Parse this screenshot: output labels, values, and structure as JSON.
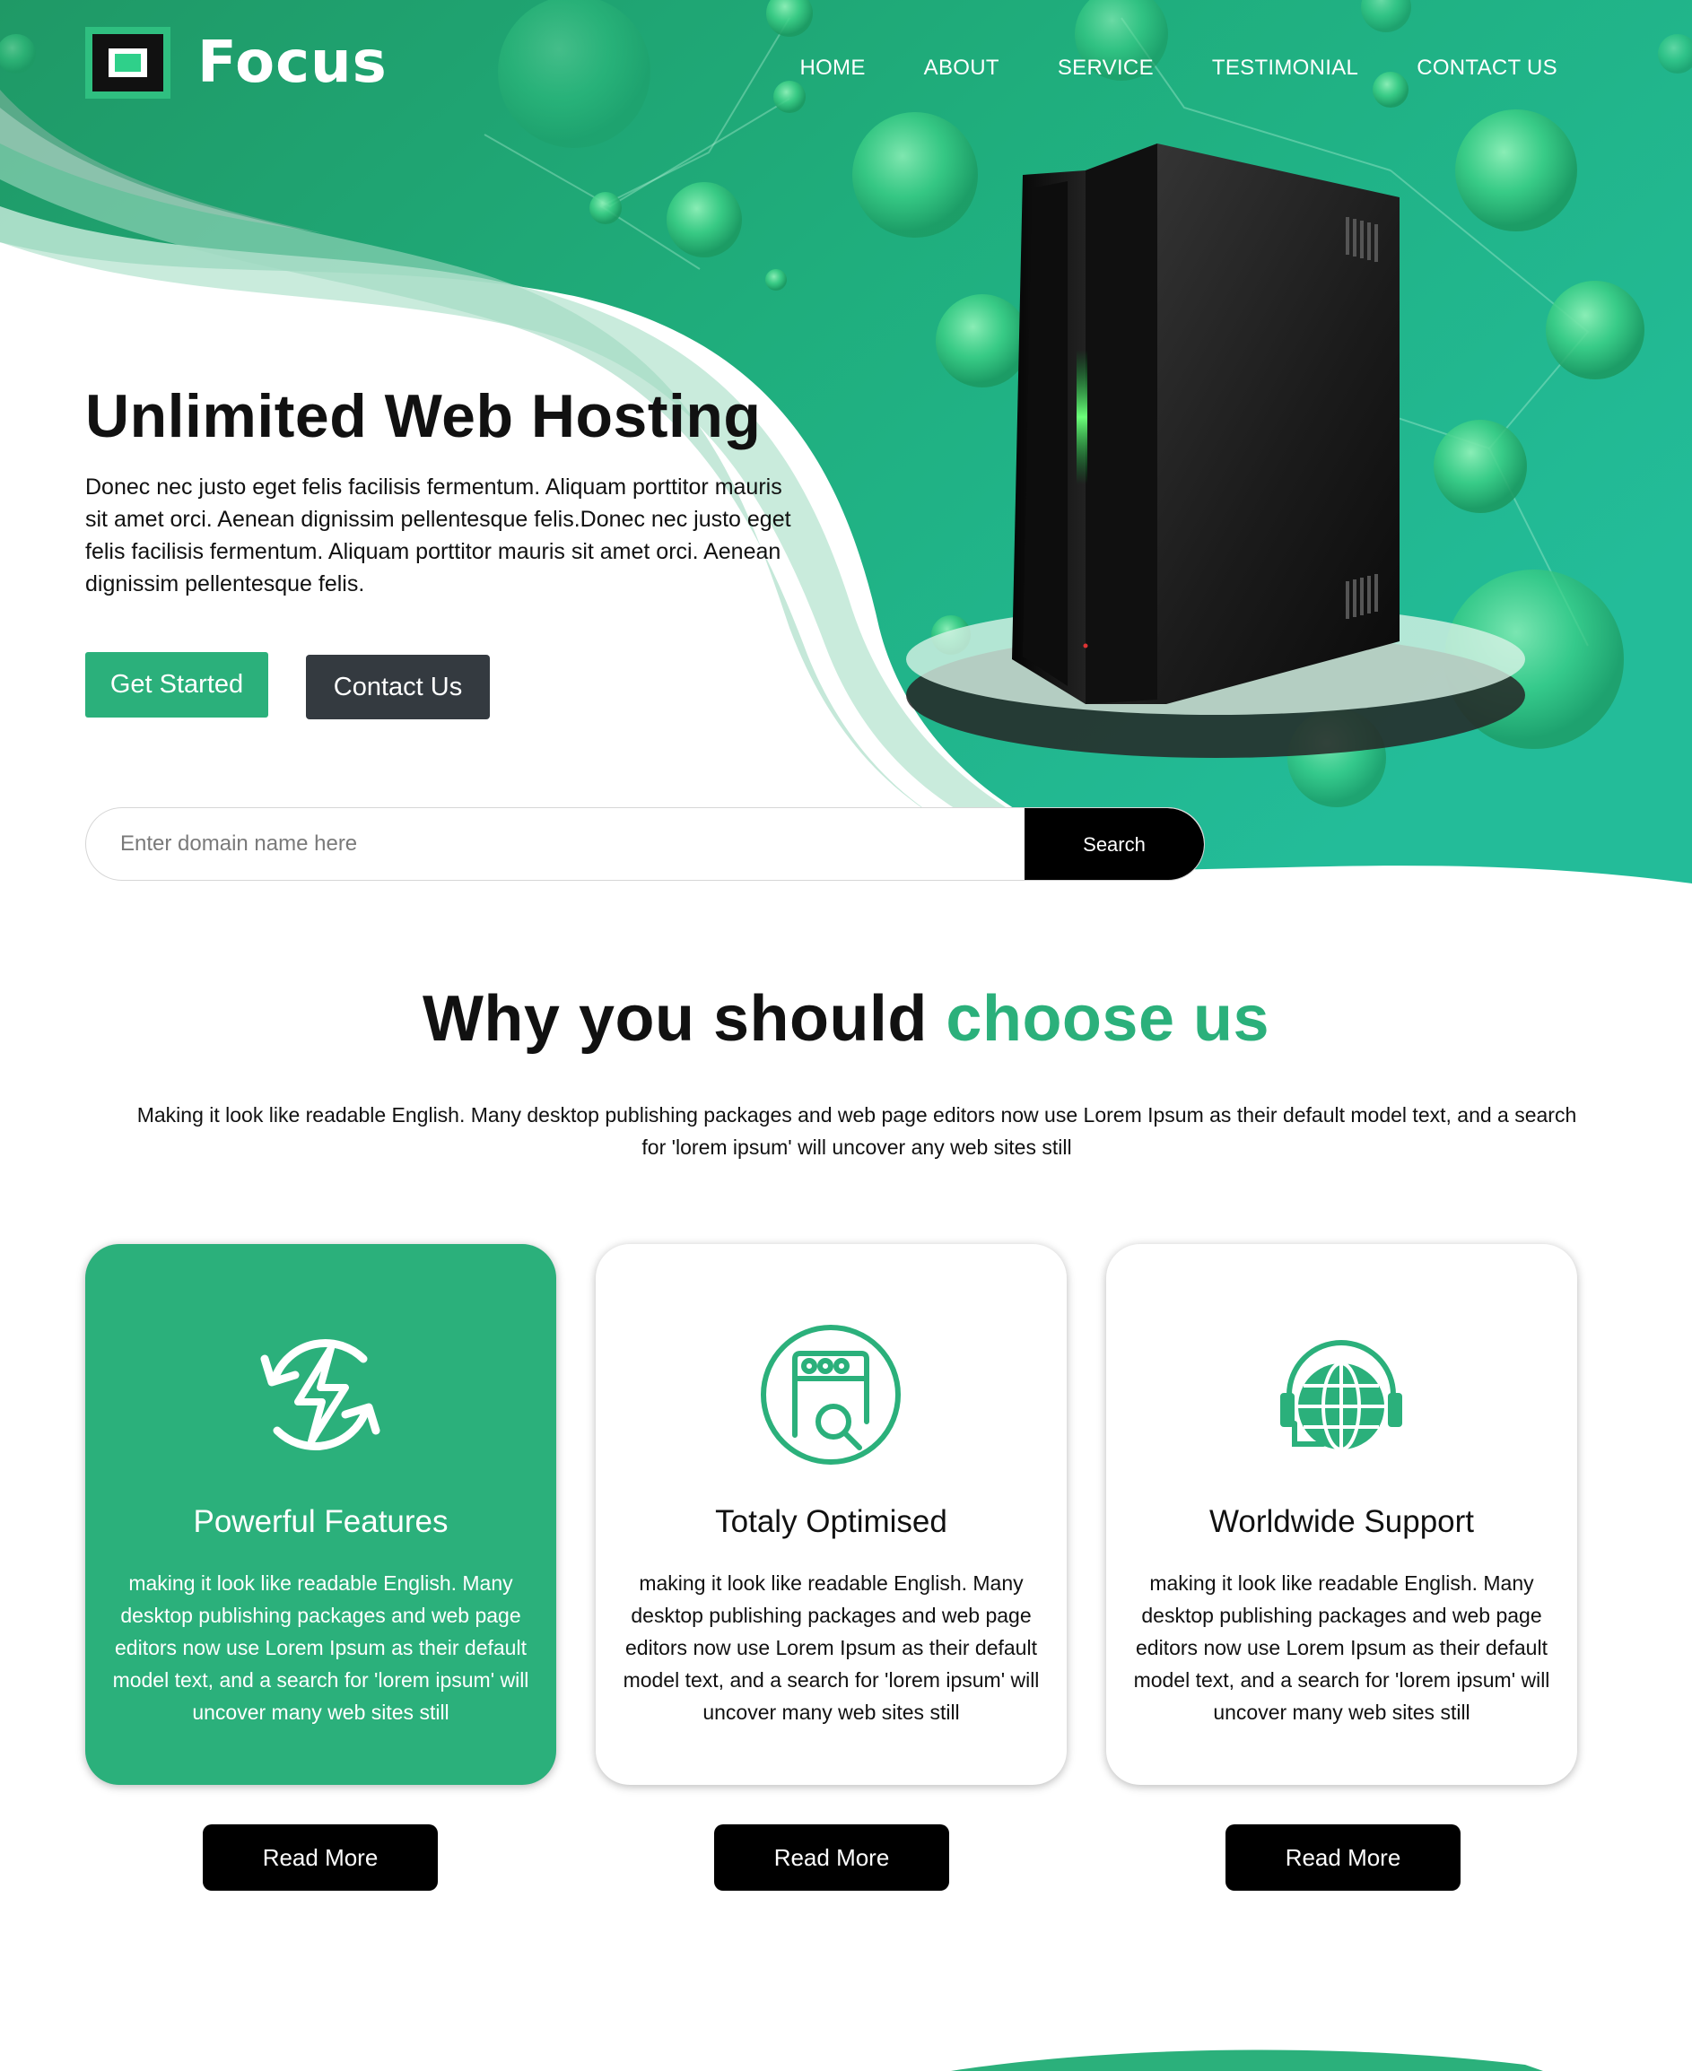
{
  "brand": {
    "name": "Focus"
  },
  "nav": {
    "items": [
      "HOME",
      "ABOUT",
      "SERVICE",
      "TESTIMONIAL",
      "CONTACT US"
    ]
  },
  "hero": {
    "title": "Unlimited Web Hosting",
    "text": "Donec nec justo eget felis facilisis fermentum. Aliquam porttitor mauris sit amet orci. Aenean dignissim pellentesque felis.Donec nec justo eget felis facilisis fermentum. Aliquam porttitor mauris sit amet orci. Aenean dignissim pellentesque felis.",
    "primary_button": "Get Started",
    "secondary_button": "Contact Us"
  },
  "search": {
    "placeholder": "Enter domain name here",
    "button_label": "Search"
  },
  "why": {
    "title_plain": "Why you should ",
    "title_accent": "choose us",
    "text": "Making it look like readable English. Many desktop publishing packages and web page editors now use Lorem Ipsum as their default model text, and a search for 'lorem ipsum' will uncover any web sites still"
  },
  "cards": [
    {
      "title": "Powerful Features",
      "text": "making it look like readable English. Many desktop publishing packages and web page editors now use Lorem Ipsum as their default model text, and a search for 'lorem ipsum' will uncover many web sites still",
      "button": "Read More",
      "icon": "lightning-refresh-icon"
    },
    {
      "title": "Totaly Optimised",
      "text": "making it look like readable English. Many desktop publishing packages and web page editors now use Lorem Ipsum as their default model text, and a search for 'lorem ipsum' will uncover many web sites still",
      "button": "Read More",
      "icon": "browser-search-icon"
    },
    {
      "title": "Worldwide Support",
      "text": "making it look like readable English. Many desktop publishing packages and web page editors now use Lorem Ipsum as their default model text, and a search for 'lorem ipsum' will uncover many web sites still",
      "button": "Read More",
      "icon": "globe-headset-icon"
    }
  ],
  "colors": {
    "accent": "#2bb07b",
    "hero_green_dark": "#1f9a6a",
    "hero_green_light": "#24c09a",
    "dark_button": "#343a40",
    "black": "#000000"
  }
}
